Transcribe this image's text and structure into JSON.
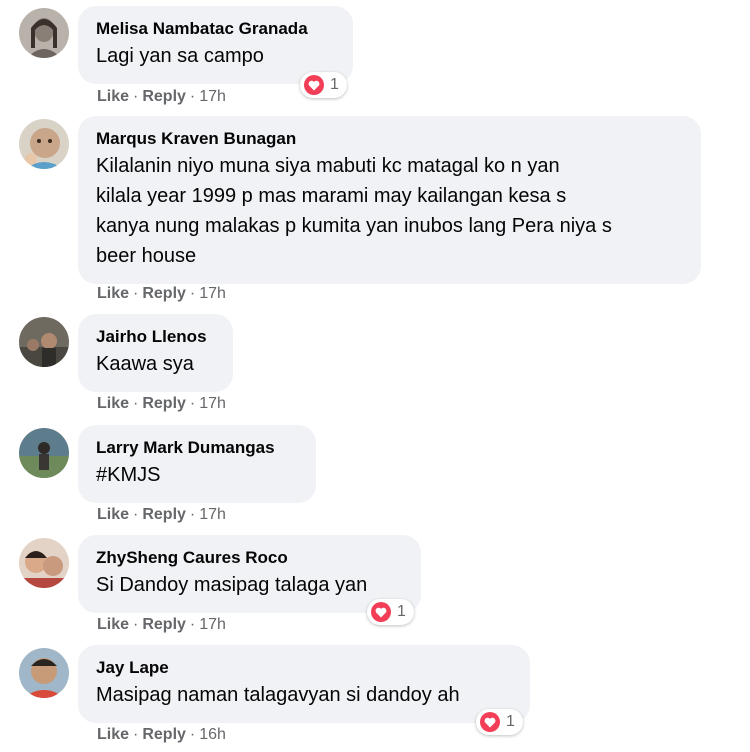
{
  "actions": {
    "like": "Like",
    "reply": "Reply",
    "dot": "·"
  },
  "colors": {
    "bubble": "#f0f2f5",
    "meta": "#65676b",
    "heart": "#f33e58"
  },
  "comments": [
    {
      "author": "Melisa Nambatac Granada",
      "text": "Lagi yan sa campo",
      "time": "17h",
      "reactions": {
        "type": "heart-icon",
        "count": "1"
      }
    },
    {
      "author": "Marqus Kraven Bunagan",
      "text": "Kilalanin niyo muna siya mabuti kc matagal ko n yan\nkilala year 1999 p mas marami may kailangan kesa s\nkanya nung malakas p kumita yan inubos lang Pera niya s\nbeer house",
      "time": "17h"
    },
    {
      "author": "Jairho Llenos",
      "text": "Kaawa sya",
      "time": "17h"
    },
    {
      "author": "Larry Mark Dumangas",
      "text": "#KMJS",
      "time": "17h"
    },
    {
      "author": "ZhySheng Caures Roco",
      "text": "Si Dandoy masipag talaga yan",
      "time": "17h",
      "reactions": {
        "type": "heart-icon",
        "count": "1"
      }
    },
    {
      "author": "Jay Lape",
      "text": "Masipag naman talagavyan si dandoy ah",
      "time": "16h",
      "reactions": {
        "type": "heart-icon",
        "count": "1"
      }
    }
  ]
}
